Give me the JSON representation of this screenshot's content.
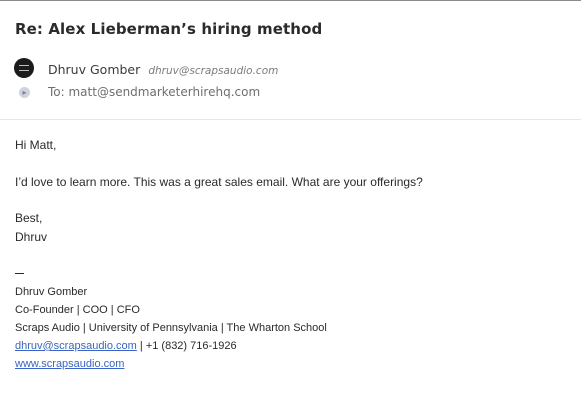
{
  "email": {
    "subject": "Re: Alex Lieberman’s hiring method",
    "from_name": "Dhruv Gomber",
    "from_email": "dhruv@scrapsaudio.com",
    "to_line": "To: matt@sendmarketerhirehq.com",
    "body": {
      "greeting": "Hi Matt,",
      "line1": "I’d love to learn more. This was a great sales email. What are your offerings?",
      "closing": "Best,",
      "name": "Dhruv"
    },
    "signature": {
      "name": "Dhruv Gomber",
      "title": "Co-Founder | COO | CFO",
      "org": "Scraps Audio | University of Pennsylvania | The Wharton School",
      "email_link": "dhruv@scrapsaudio.com",
      "phone": " | +1 (832) 716-1926",
      "website": "www.scrapsaudio.com"
    }
  },
  "icons": {
    "avatar": "company-logo-avatar",
    "recipient": "chevron-right-icon"
  },
  "colors": {
    "link": "#3a64c4",
    "text": "#2a2a2a",
    "muted": "#7b7b7b"
  }
}
